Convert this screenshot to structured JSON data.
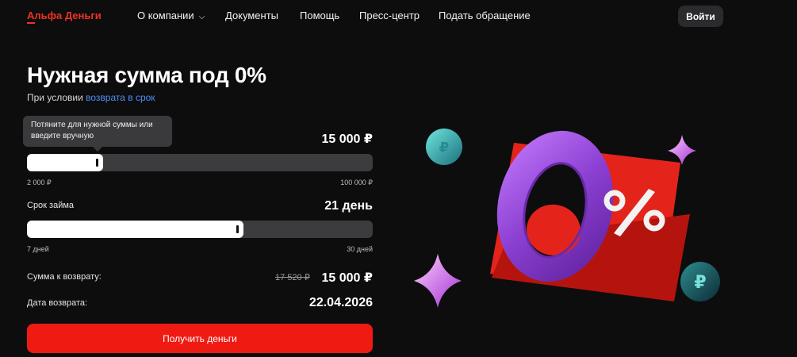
{
  "header": {
    "logo": "Альфа Деньги",
    "nav": [
      {
        "label": "О компании",
        "has_dropdown": true
      },
      {
        "label": "Документы"
      },
      {
        "label": "Помощь"
      },
      {
        "label": "Пресс-центр"
      },
      {
        "label": "Подать обращение"
      }
    ],
    "login": "Войти"
  },
  "hero": {
    "title": "Нужная сумма под 0%",
    "subtitle_prefix": "При условии ",
    "subtitle_link": "возврата в срок"
  },
  "calculator": {
    "tooltip": "Потяните для нужной суммы или введите вручную",
    "amount": {
      "value": "15 000 ₽",
      "min_label": "2 000 ₽",
      "max_label": "100 000 ₽",
      "fill_fraction": 0.22
    },
    "term": {
      "label": "Срок займа",
      "value": "21 день",
      "min_label": "7 дней",
      "max_label": "30 дней",
      "fill_fraction": 0.625
    },
    "repay": {
      "label": "Сумма к возврату:",
      "old_value": "17 520 ₽",
      "value": "15 000 ₽"
    },
    "date": {
      "label": "Дата возврата:",
      "value": "22.04.2026"
    },
    "cta": "Получить деньги"
  },
  "art": {
    "headline": "0%",
    "coin_symbol": "₽"
  },
  "colors": {
    "brand": "#ef3124",
    "cta": "#ef1b13",
    "link": "#4f8ef7",
    "background": "#0d0d0e"
  }
}
